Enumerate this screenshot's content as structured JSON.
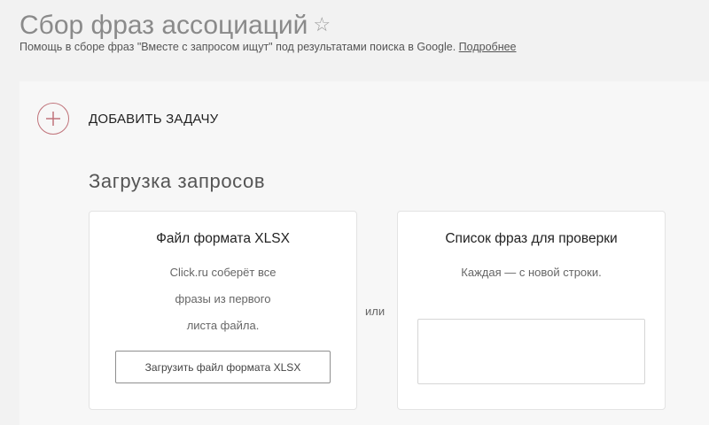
{
  "header": {
    "title": "Сбор фраз ассоциаций",
    "favorite_icon": "star-outline-icon",
    "subtitle": "Помощь в сборе фраз \"Вместе с запросом ищут\" под результатами поиска в Google.",
    "more_link": "Подробнее"
  },
  "add_task": {
    "icon": "plus-circle-icon",
    "label": "ДОБАВИТЬ ЗАДАЧУ",
    "accent_color": "#c0737a"
  },
  "upload": {
    "section_title": "Загрузка запросов",
    "xlsx_card": {
      "title": "Файл формата XLSX",
      "description_lines": [
        "Click.ru соберёт все",
        "фразы из первого",
        "листа файла."
      ],
      "button_label": "Загрузить файл формата XLSX"
    },
    "or_label": "или",
    "list_card": {
      "title": "Список фраз для проверки",
      "description": "Каждая — с новой строки.",
      "textarea_value": ""
    }
  }
}
